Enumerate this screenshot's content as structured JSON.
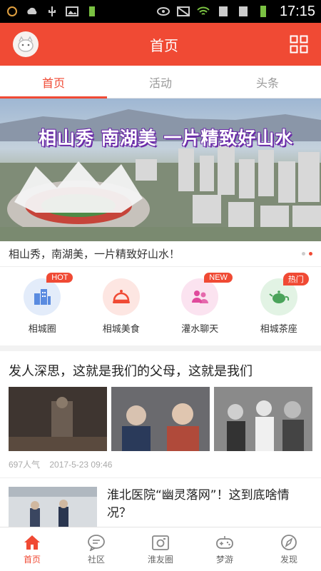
{
  "status": {
    "time": "17:15"
  },
  "header": {
    "title": "首页",
    "avatar_icon": "avatar-icon",
    "menu_icon": "grid-icon"
  },
  "tabs": [
    {
      "label": "首页",
      "active": true
    },
    {
      "label": "活动",
      "active": false
    },
    {
      "label": "头条",
      "active": false
    }
  ],
  "banner": {
    "title": "相山秀 南湖美 一片精致好山水",
    "caption": "相山秀，南湖美，一片精致好山水！",
    "slide_count": 2,
    "active_slide": 2
  },
  "categories": [
    {
      "label": "相城圈",
      "badge": "HOT",
      "icon": "buildings-icon",
      "color": "#5a8be0",
      "bg": "#e3ecfa"
    },
    {
      "label": "相城美食",
      "badge": "",
      "icon": "food-cover-icon",
      "color": "#f04a34",
      "bg": "#fde6e2"
    },
    {
      "label": "灌水聊天",
      "badge": "NEW",
      "icon": "people-chat-icon",
      "color": "#e04a9c",
      "bg": "#fbe3f0"
    },
    {
      "label": "相城茶座",
      "badge": "热门",
      "icon": "teapot-icon",
      "color": "#4aa35a",
      "bg": "#e2f3e4"
    }
  ],
  "articles": [
    {
      "title": "发人深思，这就是我们的父母，这就是我们",
      "views": "697人气",
      "date": "2017-5-23 09:46"
    },
    {
      "title": "淮北医院“幽灵落网”！这到底啥情况？"
    }
  ],
  "bottom_nav": [
    {
      "label": "首页",
      "icon": "home-icon",
      "active": true
    },
    {
      "label": "社区",
      "icon": "chat-bubble-icon",
      "active": false
    },
    {
      "label": "淮友圈",
      "icon": "camera-icon",
      "active": false
    },
    {
      "label": "梦游",
      "icon": "gamepad-icon",
      "active": false
    },
    {
      "label": "发现",
      "icon": "compass-icon",
      "active": false
    }
  ],
  "colors": {
    "brand": "#f04a34",
    "text": "#222222",
    "muted": "#aaaaaa"
  }
}
